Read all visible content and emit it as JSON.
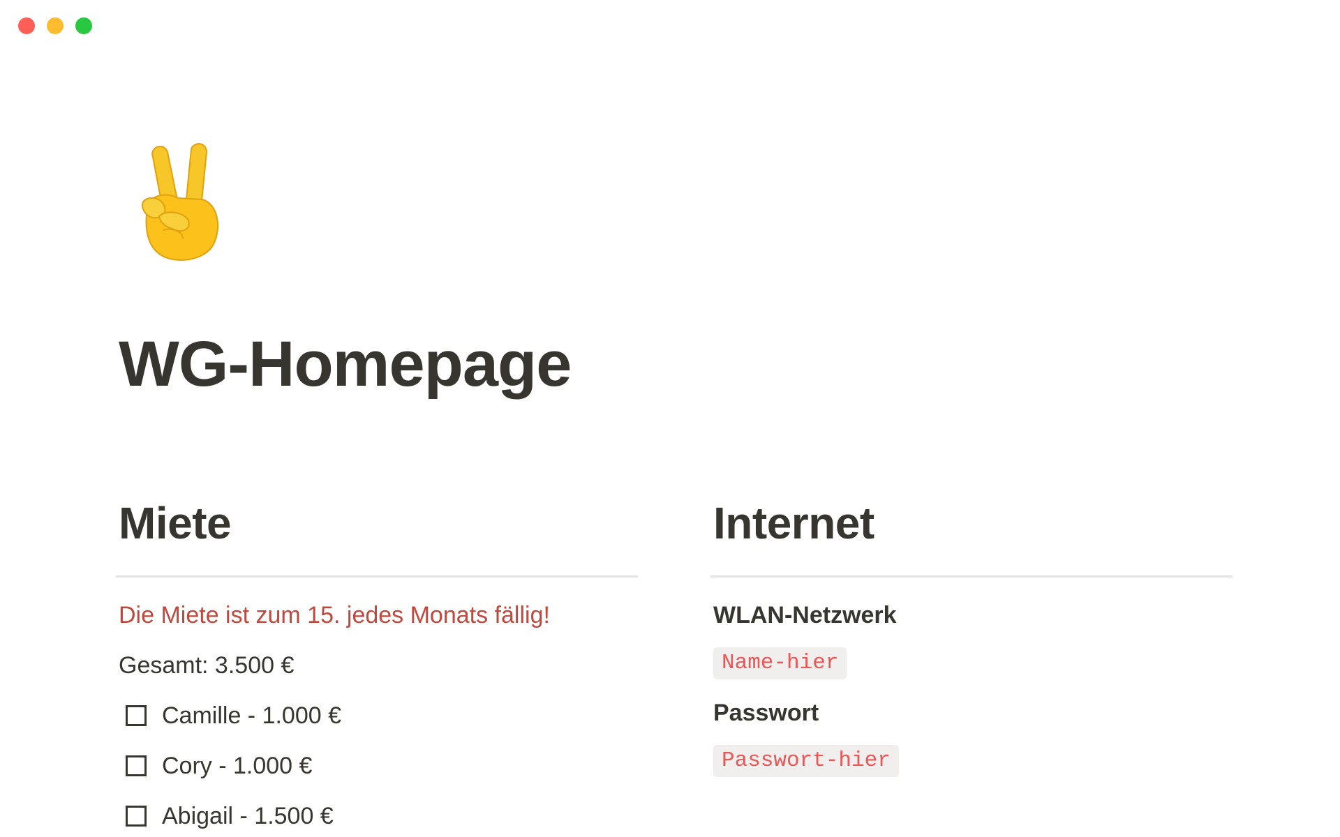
{
  "window": {
    "controls": [
      "close",
      "minimize",
      "zoom"
    ]
  },
  "page": {
    "icon": "victory-hand-emoji",
    "title": "WG-Homepage"
  },
  "rent": {
    "heading": "Miete",
    "notice": "Die Miete ist zum 15. jedes Monats fällig!",
    "total": "Gesamt: 3.500 €",
    "todos": [
      {
        "label": "Camille - 1.000 €",
        "checked": false
      },
      {
        "label": "Cory - 1.000 €",
        "checked": false
      },
      {
        "label": "Abigail - 1.500 €",
        "checked": false
      }
    ]
  },
  "internet": {
    "heading": "Internet",
    "wifi_label": "WLAN-Netzwerk",
    "wifi_value": "Name-hier",
    "password_label": "Passwort",
    "password_value": "Passwort-hier"
  },
  "colors": {
    "text": "#37352f",
    "alert": "#c0483d",
    "code_text": "#eb5757",
    "code_bg": "#f0efed",
    "divider": "#e3e2e0"
  }
}
